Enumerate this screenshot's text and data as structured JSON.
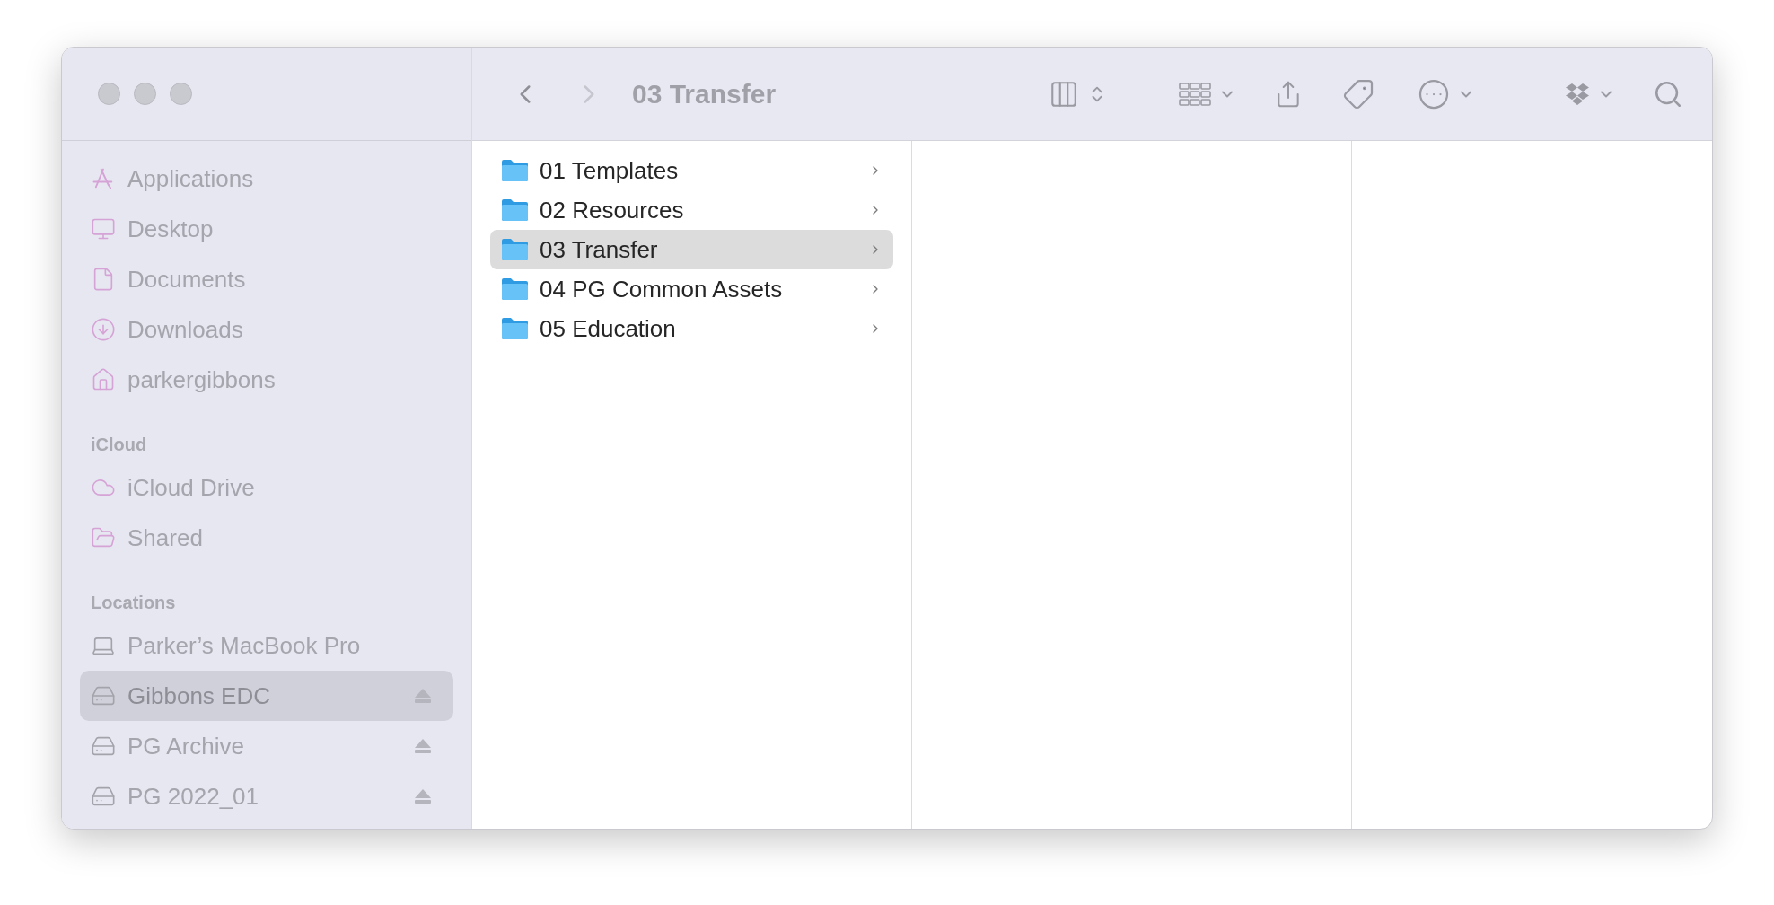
{
  "window": {
    "title": "03 Transfer"
  },
  "toolbar": {
    "back": {
      "disabled": false
    },
    "forward": {
      "disabled": true
    }
  },
  "sidebar": [
    {
      "items": [
        {
          "label": "Applications",
          "kind": "applications",
          "selected": false
        },
        {
          "label": "Desktop",
          "kind": "desktop",
          "selected": false
        },
        {
          "label": "Documents",
          "kind": "documents",
          "selected": false
        },
        {
          "label": "Downloads",
          "kind": "downloads",
          "selected": false
        },
        {
          "label": "parkergibbons",
          "kind": "home",
          "selected": false
        }
      ]
    },
    {
      "header": "iCloud",
      "items": [
        {
          "label": "iCloud Drive",
          "kind": "cloud",
          "selected": false
        },
        {
          "label": "Shared",
          "kind": "shared",
          "selected": false
        }
      ]
    },
    {
      "header": "Locations",
      "items": [
        {
          "label": "Parker’s MacBook Pro",
          "kind": "laptop",
          "selected": false,
          "ejectable": false
        },
        {
          "label": "Gibbons EDC",
          "kind": "drive",
          "selected": true,
          "ejectable": true
        },
        {
          "label": "PG Archive",
          "kind": "drive",
          "selected": false,
          "ejectable": true
        },
        {
          "label": "PG 2022_01",
          "kind": "drive",
          "selected": false,
          "ejectable": true
        }
      ]
    }
  ],
  "browser": {
    "column_1": [
      {
        "name": "01 Templates",
        "selected": false
      },
      {
        "name": "02 Resources",
        "selected": false
      },
      {
        "name": "03 Transfer",
        "selected": true
      },
      {
        "name": "04 PG Common Assets",
        "selected": false
      },
      {
        "name": "05 Education",
        "selected": false
      }
    ]
  }
}
